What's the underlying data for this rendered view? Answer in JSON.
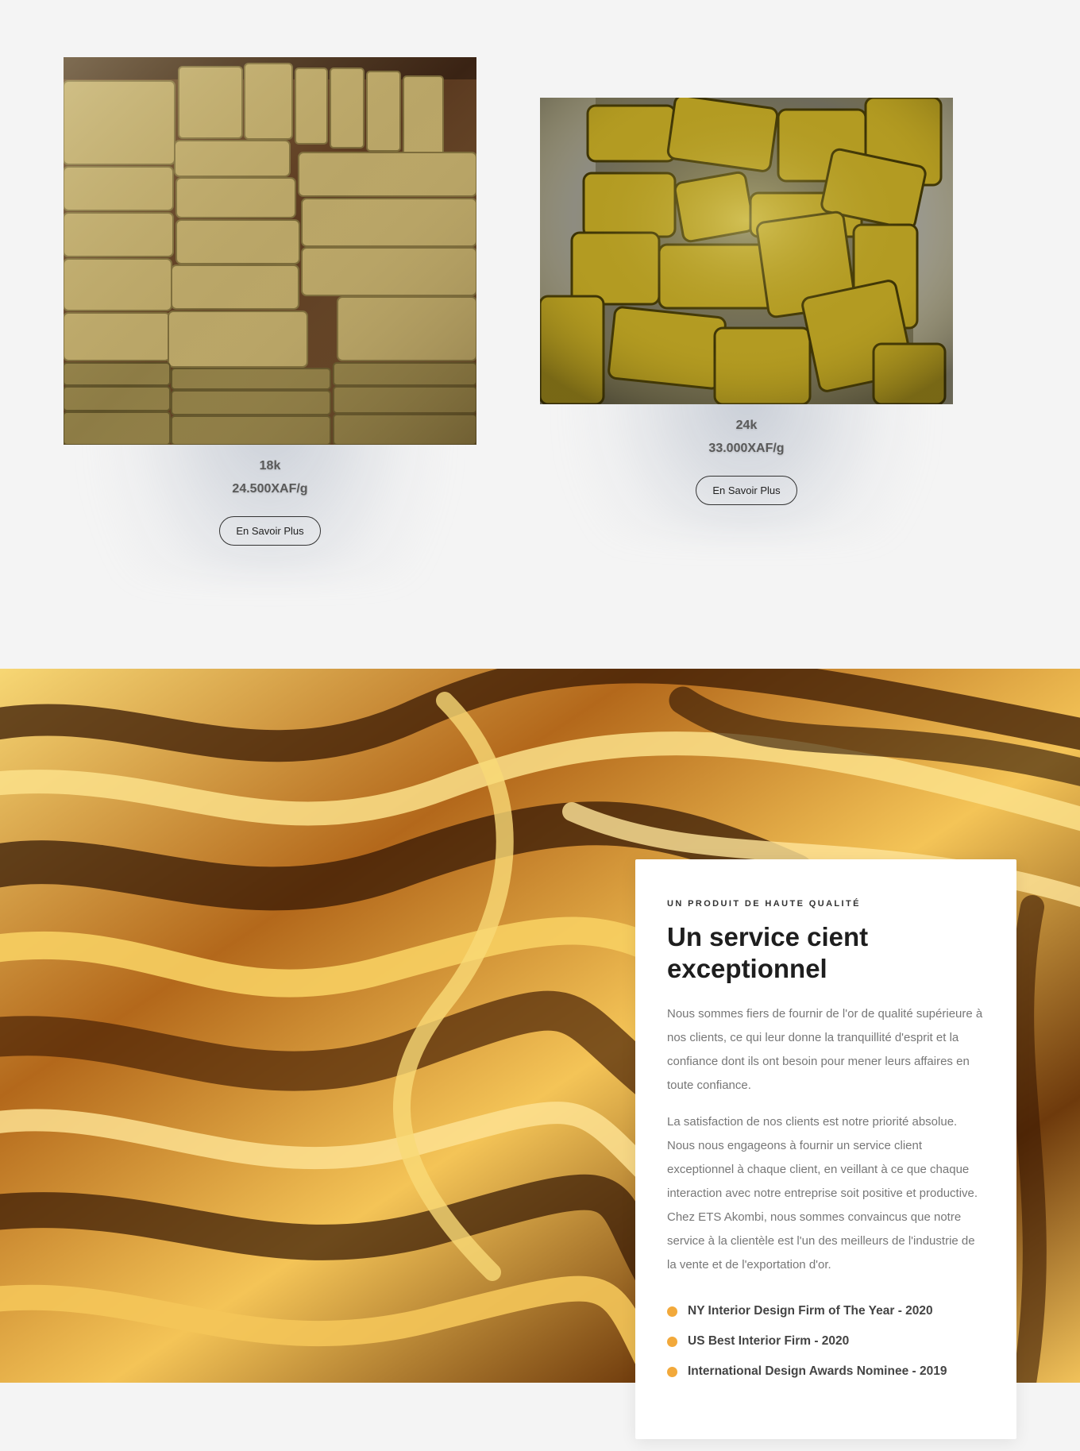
{
  "products": [
    {
      "karat": "18k",
      "price": "24.500XAF/g",
      "button_label": "En Savoir Plus"
    },
    {
      "karat": "24k",
      "price": "33.000XAF/g",
      "button_label": "En Savoir Plus"
    }
  ],
  "feature": {
    "eyebrow": "UN PRODUIT DE HAUTE QUALITÉ",
    "title": "Un service cient exceptionnel",
    "paragraph_1": "Nous sommes fiers de fournir de l'or de qualité supérieure à nos clients, ce qui leur donne la tranquillité d'esprit et la confiance dont ils ont besoin pour mener leurs affaires en toute confiance.",
    "paragraph_2": "La satisfaction de nos clients est notre priorité absolue. Nous nous engageons à fournir un service client exceptionnel à chaque client, en veillant à ce que chaque interaction avec notre entreprise soit positive et productive. Chez ETS Akombi, nous sommes convaincus que notre service à la clientèle est l'un des meilleurs de l'industrie de la vente et de l'exportation d'or.",
    "awards": [
      "NY Interior Design Firm of The Year - 2020",
      "US Best Interior Firm - 2020",
      "International Design Awards Nominee - 2019"
    ]
  },
  "colors": {
    "accent": "#f2a93b",
    "page_bg": "#f4f4f4",
    "gold": "#d9a441"
  }
}
